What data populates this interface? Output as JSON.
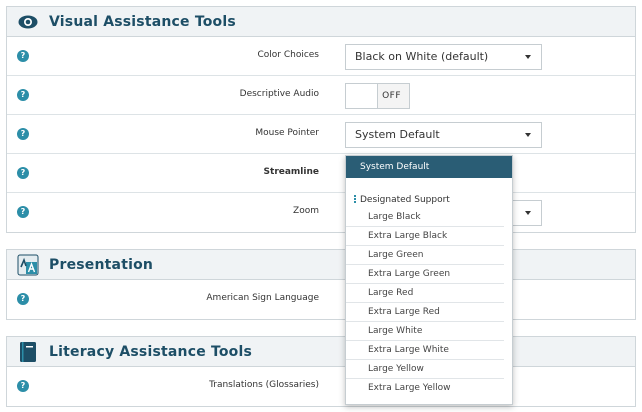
{
  "sections": {
    "visual": {
      "title": "Visual Assistance Tools",
      "icon": "eye-icon",
      "rows": {
        "color_choices": {
          "label": "Color Choices",
          "value": "Black on White (default)"
        },
        "descriptive_audio": {
          "label": "Descriptive Audio",
          "value": "OFF"
        },
        "mouse_pointer": {
          "label": "Mouse Pointer",
          "value": "System Default"
        },
        "streamline": {
          "label": "Streamline"
        },
        "zoom": {
          "label": "Zoom"
        }
      }
    },
    "presentation": {
      "title": "Presentation",
      "icon": "sign-language-icon",
      "rows": {
        "asl": {
          "label": "American Sign Language"
        }
      }
    },
    "literacy": {
      "title": "Literacy Assistance Tools",
      "icon": "book-icon",
      "rows": {
        "translations": {
          "label": "Translations (Glossaries)"
        }
      }
    }
  },
  "pointer_dropdown": {
    "selected": "System Default",
    "group_label": "Designated Support",
    "options": [
      "Large Black",
      "Extra Large Black",
      "Large Green",
      "Extra Large Green",
      "Large Red",
      "Extra Large Red",
      "Large White",
      "Extra Large White",
      "Large Yellow",
      "Extra Large Yellow"
    ]
  },
  "colors": {
    "accent": "#2c8ea8",
    "heading": "#1d4e66",
    "dropdown_selected": "#2a5d75"
  }
}
